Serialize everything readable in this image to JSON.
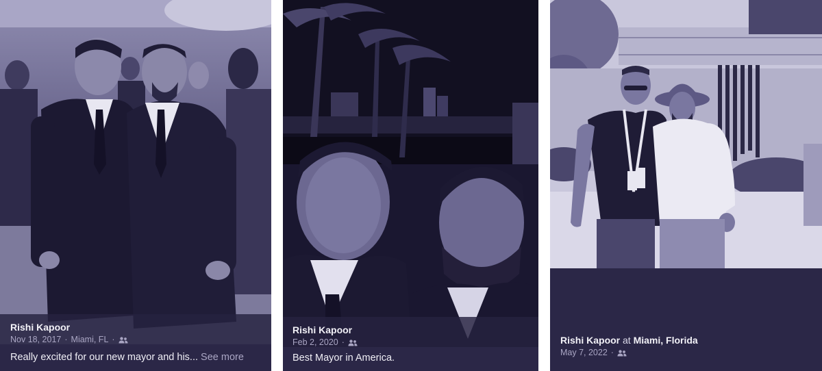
{
  "posts": [
    {
      "author": "Rishi Kapoor",
      "date": "Nov 18, 2017",
      "location": "Miami, FL",
      "audience_icon": "friends-icon",
      "caption": "Really excited for our new mayor and his...",
      "see_more": "See more"
    },
    {
      "author": "Rishi Kapoor",
      "date": "Feb 2, 2020",
      "audience_icon": "friends-icon",
      "caption": "Best Mayor in America."
    },
    {
      "author": "Rishi Kapoor",
      "at_word": "at",
      "location": "Miami, Florida",
      "date": "May 7, 2022",
      "audience_icon": "friends-icon"
    }
  ],
  "colors": {
    "overlay": "#2b2747",
    "tint": "#6b6799",
    "meta_text": "#aaa6c4"
  }
}
